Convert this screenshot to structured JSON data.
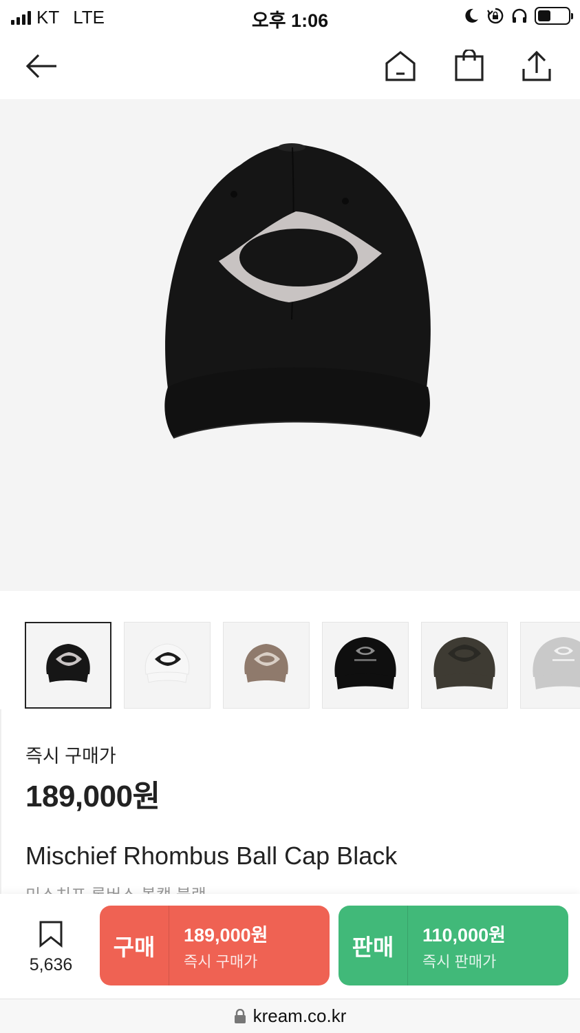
{
  "status_bar": {
    "carrier": "KT",
    "network": "LTE",
    "time": "오후 1:06"
  },
  "nav": {
    "icons": [
      "back-arrow-icon",
      "home-icon",
      "shopping-bag-icon",
      "share-icon"
    ]
  },
  "thumbnails": [
    {
      "color_name": "black",
      "cap_color": "#161616",
      "logo_color": "#c9c4c4"
    },
    {
      "color_name": "white",
      "cap_color": "#f7f7f7",
      "logo_color": "#1c1c1c"
    },
    {
      "color_name": "brown",
      "cap_color": "#8f7a6c",
      "logo_color": "#d9cfc6"
    },
    {
      "color_name": "black-wordmark",
      "cap_color": "#0f0f0f",
      "logo_color": "#8a8a8a"
    },
    {
      "color_name": "olive-charcoal",
      "cap_color": "#3e3b33",
      "logo_color": "#2a2924"
    },
    {
      "color_name": "light-gray",
      "cap_color": "#c9c9c9",
      "logo_color": "#f2f2f2"
    }
  ],
  "product": {
    "price_label": "즉시 구매가",
    "price": "189,000원",
    "name": "Mischief Rhombus Ball Cap Black",
    "name_kr": "미스치프 롬버스 볼캡 블랙"
  },
  "action_bar": {
    "wish_count": "5,636",
    "buy": {
      "label": "구매",
      "price": "189,000원",
      "sub": "즉시 구매가",
      "color": "#ef6253"
    },
    "sell": {
      "label": "판매",
      "price": "110,000원",
      "sub": "즉시 판매가",
      "color": "#41b979"
    }
  },
  "url_bar": {
    "url": "kream.co.kr"
  }
}
